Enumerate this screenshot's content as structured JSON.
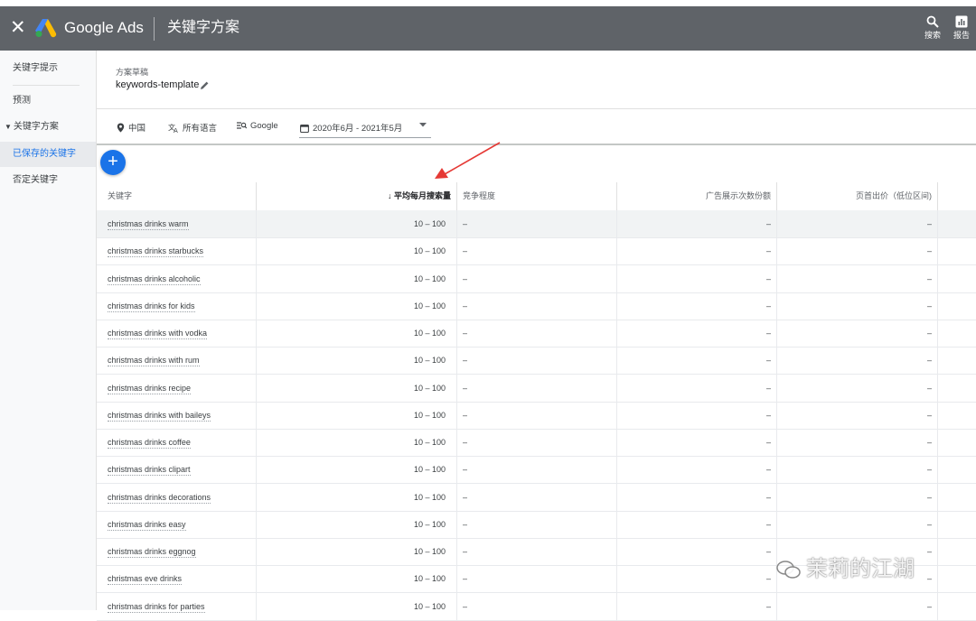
{
  "header": {
    "close_icon": "close-icon",
    "brand": "Google Ads",
    "title": "关键字方案",
    "actions": [
      {
        "label": "搜索",
        "icon": "search-icon"
      },
      {
        "label": "报告",
        "icon": "bar-chart-icon"
      }
    ]
  },
  "sidebar": {
    "items": [
      {
        "label": "关键字提示"
      },
      {
        "label": "预测"
      },
      {
        "label": "关键字方案",
        "expanded": true
      },
      {
        "label": "已保存的关键字",
        "active": true
      },
      {
        "label": "否定关键字"
      }
    ]
  },
  "plan": {
    "label": "方案草稿",
    "name": "keywords-template"
  },
  "filters": {
    "location": "中国",
    "language": "所有语言",
    "network": "Google",
    "date_range": "2020年6月 - 2021年5月"
  },
  "table": {
    "columns": [
      "关键字",
      "平均每月搜索量",
      "竞争程度",
      "广告展示次数份额",
      "页首出价（低位区间)"
    ],
    "sorted_column": "平均每月搜索量",
    "rows": [
      {
        "keyword": "christmas drinks warm",
        "searches": "10 – 100",
        "competition": "–",
        "impression_share": "–",
        "top_bid_low": "–"
      },
      {
        "keyword": "christmas drinks starbucks",
        "searches": "10 – 100",
        "competition": "–",
        "impression_share": "–",
        "top_bid_low": "–"
      },
      {
        "keyword": "christmas drinks alcoholic",
        "searches": "10 – 100",
        "competition": "–",
        "impression_share": "–",
        "top_bid_low": "–"
      },
      {
        "keyword": "christmas drinks for kids",
        "searches": "10 – 100",
        "competition": "–",
        "impression_share": "–",
        "top_bid_low": "–"
      },
      {
        "keyword": "christmas drinks with vodka",
        "searches": "10 – 100",
        "competition": "–",
        "impression_share": "–",
        "top_bid_low": "–"
      },
      {
        "keyword": "christmas drinks with rum",
        "searches": "10 – 100",
        "competition": "–",
        "impression_share": "–",
        "top_bid_low": "–"
      },
      {
        "keyword": "christmas drinks recipe",
        "searches": "10 – 100",
        "competition": "–",
        "impression_share": "–",
        "top_bid_low": "–"
      },
      {
        "keyword": "christmas drinks with baileys",
        "searches": "10 – 100",
        "competition": "–",
        "impression_share": "–",
        "top_bid_low": "–"
      },
      {
        "keyword": "christmas drinks coffee",
        "searches": "10 – 100",
        "competition": "–",
        "impression_share": "–",
        "top_bid_low": "–"
      },
      {
        "keyword": "christmas drinks clipart",
        "searches": "10 – 100",
        "competition": "–",
        "impression_share": "–",
        "top_bid_low": "–"
      },
      {
        "keyword": "christmas drinks decorations",
        "searches": "10 – 100",
        "competition": "–",
        "impression_share": "–",
        "top_bid_low": "–"
      },
      {
        "keyword": "christmas drinks easy",
        "searches": "10 – 100",
        "competition": "–",
        "impression_share": "–",
        "top_bid_low": "–"
      },
      {
        "keyword": "christmas drinks eggnog",
        "searches": "10 – 100",
        "competition": "–",
        "impression_share": "–",
        "top_bid_low": "–"
      },
      {
        "keyword": "christmas eve drinks",
        "searches": "10 – 100",
        "competition": "–",
        "impression_share": "–",
        "top_bid_low": "–"
      },
      {
        "keyword": "christmas drinks for parties",
        "searches": "10 – 100",
        "competition": "–",
        "impression_share": "–",
        "top_bid_low": "–"
      }
    ]
  },
  "annotation": {
    "color": "#e53935"
  },
  "watermark": {
    "text": "茉莉的江湖",
    "icon": "wechat-icon"
  },
  "colors": {
    "topbar": "#5f6368",
    "accent": "#1a73e8",
    "active_nav_bg": "#e8eaed"
  }
}
